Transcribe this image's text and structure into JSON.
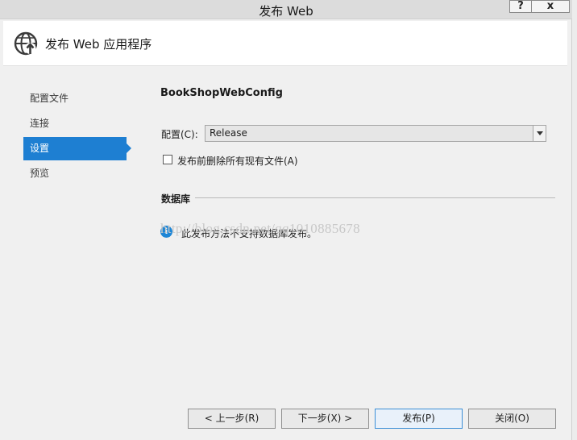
{
  "window": {
    "title": "发布 Web",
    "help_label": "?",
    "close_label": "x"
  },
  "header": {
    "title": "发布 Web 应用程序",
    "icon": "globe-publish-icon"
  },
  "sidebar": {
    "items": [
      {
        "label": "配置文件",
        "active": false
      },
      {
        "label": "连接",
        "active": false
      },
      {
        "label": "设置",
        "active": true
      },
      {
        "label": "预览",
        "active": false
      }
    ]
  },
  "settings": {
    "profile_name": "BookShopWebConfig",
    "config_label": "配置(C):",
    "config_value": "Release",
    "delete_files_label": "发布前删除所有现有文件(A)",
    "delete_files_checked": false,
    "database_section_title": "数据库",
    "database_info": "此发布方法不支持数据库发布。"
  },
  "watermark": "http://blog.csdn.net/qq1010885678",
  "footer": {
    "prev_label": "< 上一步(R)",
    "next_label": "下一步(X) >",
    "publish_label": "发布(P)",
    "close_label": "关闭(O)"
  },
  "colors": {
    "accent": "#1e7fd2",
    "info_icon": "#1e86d6",
    "window_bg": "#f0f0f0"
  }
}
